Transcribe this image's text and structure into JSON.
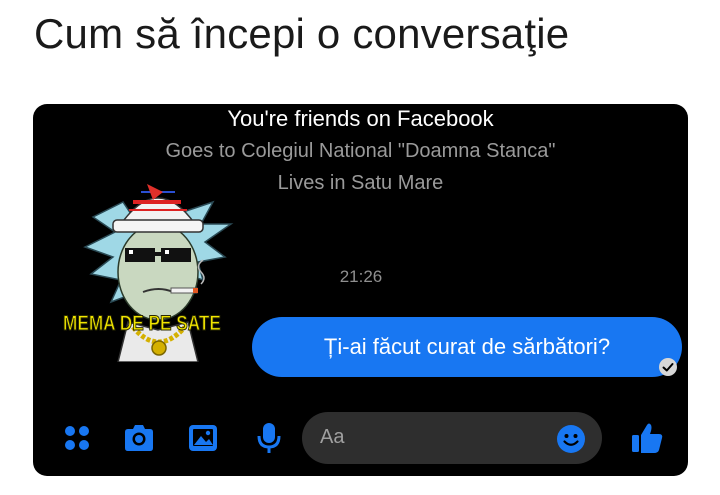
{
  "caption": "Cum să începi o conversaţie",
  "profile": {
    "friends_line": "You're friends on Facebook",
    "school_line": "Goes to Colegiul National \"Doamna Stanca\"",
    "city_line": "Lives in Satu Mare"
  },
  "timestamp": "21:26",
  "sticker": {
    "watermark": "MEMA DE PE SATE"
  },
  "message": {
    "text": "Ți-ai făcut curat de sărbători?"
  },
  "composer": {
    "placeholder": "Aa"
  },
  "colors": {
    "accent": "#1877f2",
    "panel": "#000000",
    "input": "#2e2e2e",
    "watermark": "#f2e600"
  },
  "icons": [
    "apps-icon",
    "camera-icon",
    "gallery-icon",
    "microphone-icon",
    "emoji-icon",
    "like-icon",
    "seen-check-icon"
  ]
}
